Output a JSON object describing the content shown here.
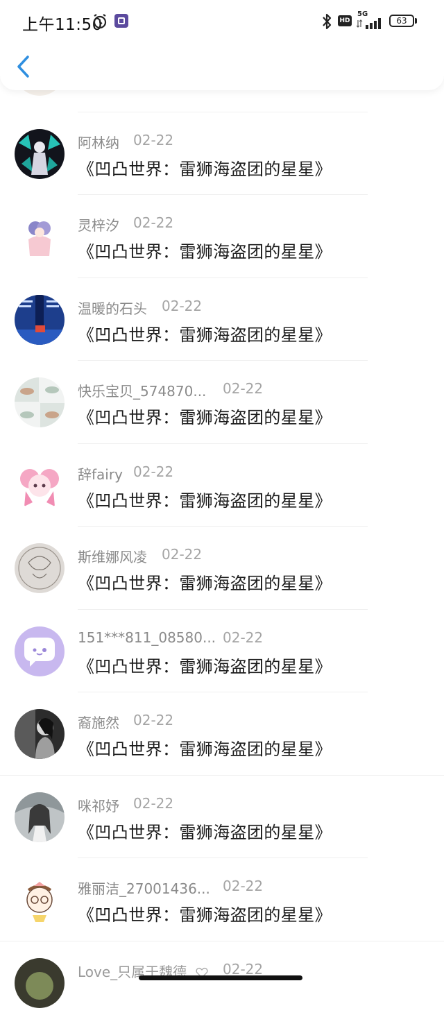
{
  "status_bar": {
    "time": "上午11:50",
    "network_label": "5G",
    "hd_label": "HD",
    "battery_level": "63"
  },
  "header": {
    "back_icon": "chevron-left-icon",
    "accent_color": "#2f8fe0"
  },
  "list": {
    "message_text": "《凹凸世界：雷狮海盗团的星星》",
    "items": [
      {
        "user": "阿林纳",
        "date": "02-22",
        "message": "《凹凸世界：雷狮海盗团的星星》"
      },
      {
        "user": "灵梓汐",
        "date": "02-22",
        "message": "《凹凸世界：雷狮海盗团的星星》"
      },
      {
        "user": "温暖的石头",
        "date": "02-22",
        "message": "《凹凸世界：雷狮海盗团的星星》"
      },
      {
        "user": "快乐宝贝_574870...",
        "date": "02-22",
        "message": "《凹凸世界：雷狮海盗团的星星》"
      },
      {
        "user": "辞fairy",
        "date": "02-22",
        "message": "《凹凸世界：雷狮海盗团的星星》"
      },
      {
        "user": "斯维娜风凌",
        "date": "02-22",
        "message": "《凹凸世界：雷狮海盗团的星星》"
      },
      {
        "user": "151***811_08580...",
        "date": "02-22",
        "message": "《凹凸世界：雷狮海盗团的星星》"
      },
      {
        "user": "裔施然",
        "date": "02-22",
        "message": "《凹凸世界：雷狮海盗团的星星》"
      },
      {
        "user": "咪祁妤",
        "date": "02-22",
        "message": "《凹凸世界：雷狮海盗团的星星》"
      },
      {
        "user": "雅丽洁_27001436...",
        "date": "02-22",
        "message": "《凹凸世界：雷狮海盗团的星星》"
      }
    ],
    "partial_item": {
      "user": "Love_只属于魏德",
      "date": "02-22"
    }
  }
}
